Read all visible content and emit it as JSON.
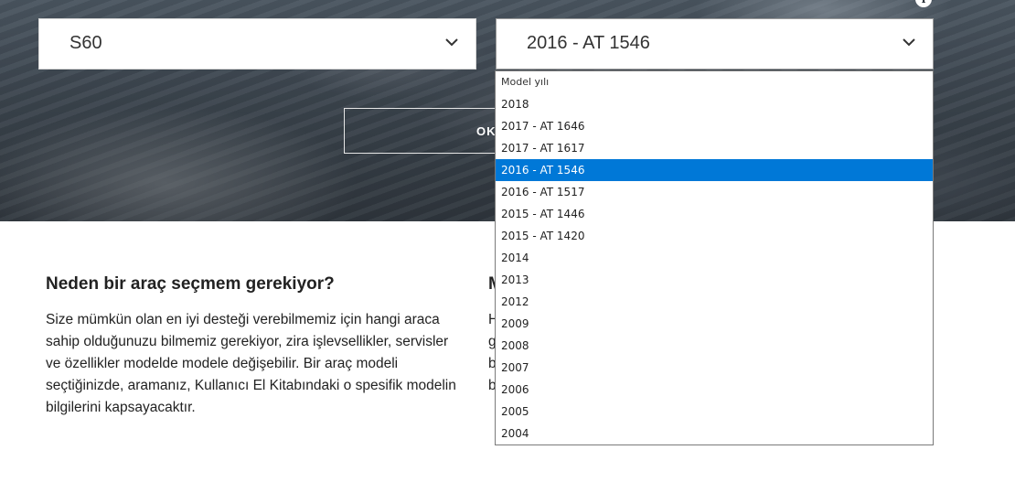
{
  "model_selector": {
    "value": "S60"
  },
  "year_selector": {
    "value": "2016 - AT 1546",
    "options_header": "Model yılı",
    "options": [
      "2018",
      "2017 - AT 1646",
      "2017 - AT 1617",
      "2016 - AT 1546",
      "2016 - AT 1517",
      "2015 - AT 1446",
      "2015 - AT 1420",
      "2014",
      "2013",
      "2012",
      "2009",
      "2008",
      "2007",
      "2006",
      "2005",
      "2004"
    ],
    "selected_index": 3
  },
  "ok_button": {
    "label": "OK"
  },
  "info": {
    "heading": "Neden bir araç seçmem gerekiyor?",
    "text": "Size mümkün olan en iyi desteği verebilmemiz için hangi araca sahip olduğunuzu bilmemiz gerekiyor, zira işlevsellikler, servisler ve özellikler modelde modele değişebilir. Bir araç modeli seçtiğinizde, aramanız, Kullanıcı El Kitabındaki o spesifik modelin bilgilerini kapsayacaktır."
  },
  "second_info": {
    "heading": "M",
    "lines": [
      "H",
      "g",
      "b",
      "b"
    ]
  },
  "colors": {
    "selected_option": "#0078d7",
    "hero_dark": "#2e353c"
  }
}
